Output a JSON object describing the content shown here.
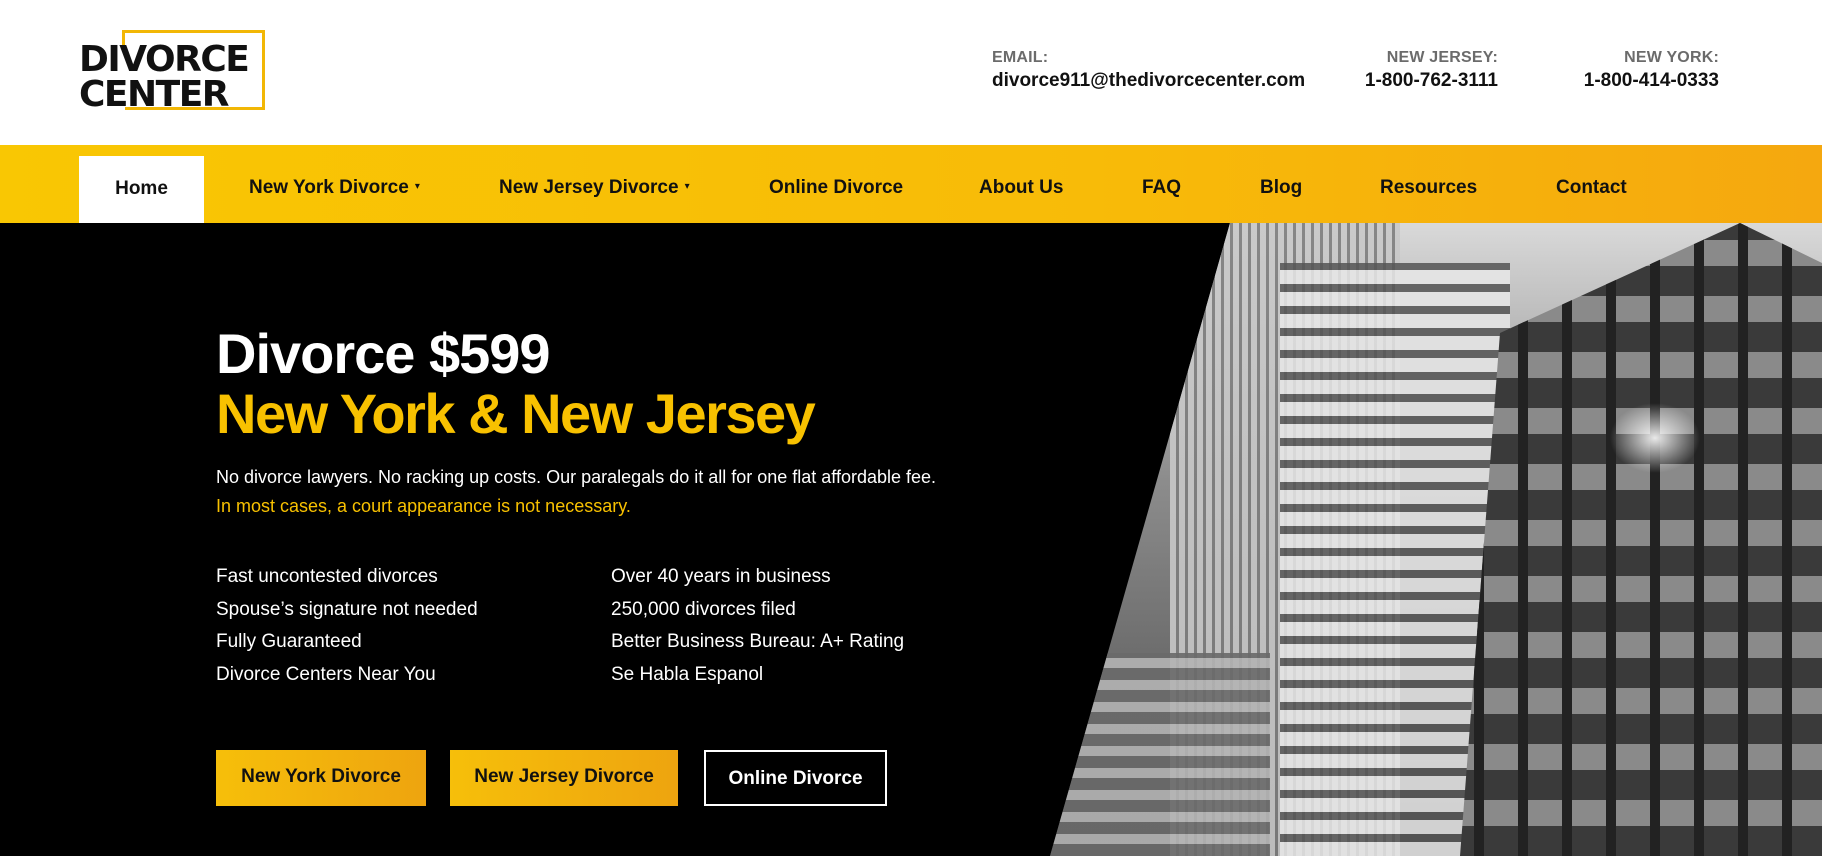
{
  "brand": {
    "logo_line1": "DIVORCE",
    "logo_line2": "CENTER",
    "accent_color": "#f8c100"
  },
  "header": {
    "email_label": "EMAIL:",
    "email": "divorce911@thedivorcecenter.com",
    "nj_label": "NEW JERSEY:",
    "nj_phone": "1-800-762-3111",
    "ny_label": "NEW YORK:",
    "ny_phone": "1-800-414-0333"
  },
  "nav": {
    "items": [
      {
        "label": "Home",
        "active": true
      },
      {
        "label": "New York Divorce",
        "dropdown": true
      },
      {
        "label": "New Jersey Divorce",
        "dropdown": true
      },
      {
        "label": "Online Divorce"
      },
      {
        "label": "About Us"
      },
      {
        "label": "FAQ"
      },
      {
        "label": "Blog"
      },
      {
        "label": "Resources"
      },
      {
        "label": "Contact"
      }
    ],
    "caret": "▾"
  },
  "hero": {
    "title_line1": "Divorce $599",
    "title_line2": "New York & New Jersey",
    "subtitle": "No divorce lawyers. No racking up costs. Our paralegals do it all for one flat affordable fee.",
    "note": "In most cases, a court appearance is not necessary.",
    "features_left": [
      "Fast uncontested divorces",
      "Spouse’s signature not needed",
      "Fully Guaranteed",
      "Divorce Centers Near You"
    ],
    "features_right": [
      "Over 40 years in business",
      "250,000 divorces filed",
      "Better Business Bureau: A+ Rating",
      "Se Habla Espanol"
    ],
    "buttons": {
      "ny": "New York Divorce",
      "nj": "New Jersey Divorce",
      "online": "Online Divorce"
    }
  }
}
